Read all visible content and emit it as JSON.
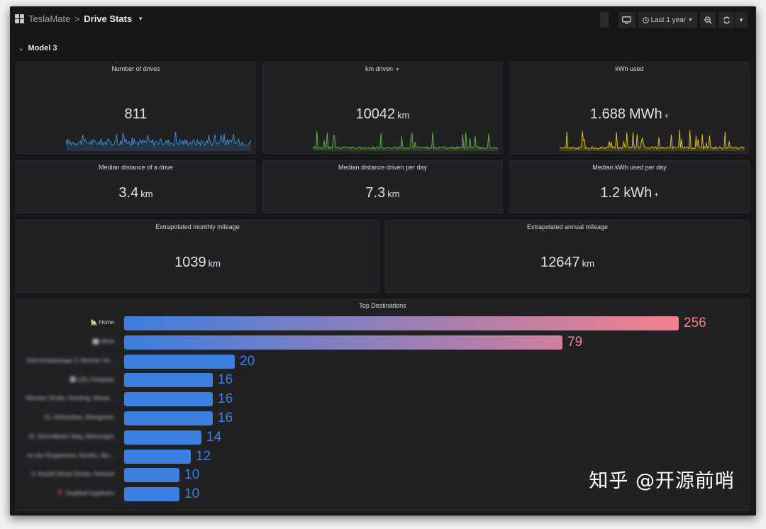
{
  "header": {
    "breadcrumb_root": "TeslaMate",
    "breadcrumb_separator": ">",
    "dashboard_title": "Drive Stats",
    "time_range": "Last 1 year",
    "icons": {
      "apps": "grid-icon",
      "tv_mode": "monitor-icon",
      "time": "clock-icon",
      "zoom_out": "zoom-out-icon",
      "refresh": "refresh-icon"
    }
  },
  "row": {
    "title": "Model 3"
  },
  "stats": {
    "number_of_drives": {
      "title": "Number of drives",
      "value": "811",
      "unit": "",
      "spark_color": "#3d8fd9"
    },
    "km_driven": {
      "title": "km driven",
      "value": "10042",
      "unit": "km",
      "spark_color": "#5fb544"
    },
    "kwh_used": {
      "title": "kWh used",
      "value": "1.688",
      "unit": "MWh",
      "suffix": "+",
      "spark_color": "#e0c420"
    },
    "median_distance_drive": {
      "title": "Median distance of a drive",
      "value": "3.4",
      "unit": "km"
    },
    "median_distance_day": {
      "title": "Median distance driven per day",
      "value": "7.3",
      "unit": "km"
    },
    "median_kwh_day": {
      "title": "Median kWh used per day",
      "value": "1.2",
      "unit": "kWh",
      "suffix": "+"
    },
    "monthly_mileage": {
      "title": "Extrapolated monthly mileage",
      "value": "1039",
      "unit": "km"
    },
    "annual_mileage": {
      "title": "Extrapolated annual mileage",
      "value": "12647",
      "unit": "km"
    }
  },
  "top_destinations": {
    "title": "Top Destinations",
    "colors": {
      "low": "#3b7fe0",
      "high": "#f57f8c"
    },
    "items": [
      {
        "label": "🏡 Home",
        "value": 256,
        "blurred": false
      },
      {
        "label": "🏢 Work",
        "value": 79,
        "blurred": true
      },
      {
        "label": "Bahnhofspassage 3, Münster Str...",
        "value": 20,
        "blurred": true
      },
      {
        "label": "🅿 LIDL Parkplatz",
        "value": 16,
        "blurred": true
      },
      {
        "label": "Münster Straße, Nordring, Weste...",
        "value": 16,
        "blurred": true
      },
      {
        "label": "15, Höhenallee, Weingarten",
        "value": 16,
        "blurred": true
      },
      {
        "label": "15, Schmidbahn Weg, Meerungen",
        "value": 14,
        "blurred": true
      },
      {
        "label": "An der Ringelwiese, Nordhu, Ber...",
        "value": 12,
        "blurred": true
      },
      {
        "label": "3, Rudolf-Diesel-Straße, Rottweil",
        "value": 10,
        "blurred": true
      },
      {
        "label": "📍 Stadtbad Ingelheim",
        "value": 10,
        "blurred": true
      }
    ]
  },
  "watermark": "知乎 @开源前哨"
}
